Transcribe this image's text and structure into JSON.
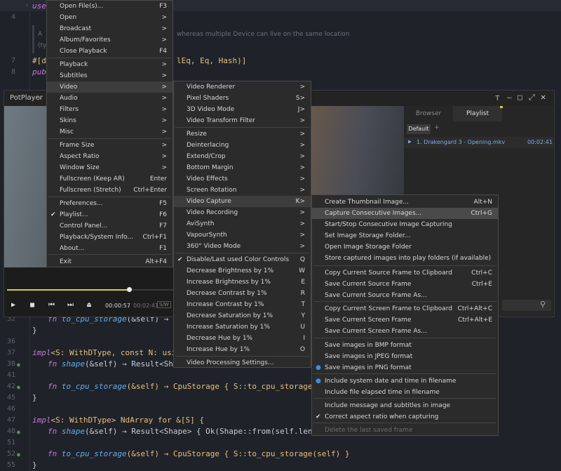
{
  "editor": {
    "line_numbers": [
      "1",
      "4",
      "7",
      "8",
      "32",
      "36",
      "37",
      "38",
      "41",
      "42",
      "45",
      "46",
      "47",
      "48",
      "51",
      "52",
      "55"
    ],
    "lines": {
      "l1": "use",
      "l4a": "A",
      "l4b": "(ty",
      "doc_tail": "whereas multiple Device can live on the same location",
      "l7a": "#[de",
      "l7b": "lEq, Eq, Hash)]",
      "l8": "pub",
      "l32a": "fn",
      "l32b": "to_cpu_storage",
      "l32c": "(&self) → CpuS",
      "l33": "}",
      "l37a": "impl",
      "l37b": "<S: WithDType, const N: usize>",
      "l38a": "fn",
      "l38b": "shape",
      "l38c": "(&self) → Result<Shape",
      "l42a": "fn",
      "l42b": "to_cpu_storage",
      "l42c": "(&self) → CpuStorage { S::to_cpu_storage(self.a",
      "l43": "}",
      "l47a": "impl",
      "l47b": "<S: WithDType> NdArray for &[S] {",
      "l48a": "fn",
      "l48b": "shape",
      "l48c": "(&self) → Result<Shape> { Ok(Shape::from(self.len())) }",
      "l52a": "fn",
      "l52b": "to_cpu_storage",
      "l52c": "(&self) → CpuStorage { S::to_cpu_storage(self) }",
      "l53": "}"
    }
  },
  "player": {
    "app_name": "PotPlayer",
    "tabs": [
      "Browser",
      "Playlist"
    ],
    "playlist_tabs": [
      "Default",
      "+"
    ],
    "playlist_item": "1. Drakengard 3 - Opening.mkv",
    "playlist_duration": "00:02:41",
    "time_current": "00:00:57",
    "time_sep": "/",
    "time_total": "00:02:41",
    "badge": "S/W",
    "progress_fraction": 0.31
  },
  "main_menu": [
    {
      "label": "Open File(s)...",
      "shortcut": "F3"
    },
    {
      "label": "Open",
      "shortcut": ">"
    },
    {
      "label": "Broadcast",
      "shortcut": ">"
    },
    {
      "label": "Album/Favorites",
      "shortcut": ">"
    },
    {
      "label": "Close Playback",
      "shortcut": "F4"
    },
    {
      "label": "Playback",
      "shortcut": ">"
    },
    {
      "label": "Subtitles",
      "shortcut": ">"
    },
    {
      "label": "Video",
      "shortcut": ">"
    },
    {
      "label": "Audio",
      "shortcut": ">"
    },
    {
      "label": "Filters",
      "shortcut": ">"
    },
    {
      "label": "Skins",
      "shortcut": ">"
    },
    {
      "label": "Misc",
      "shortcut": ">"
    },
    {
      "label": "Frame Size",
      "shortcut": ">"
    },
    {
      "label": "Aspect Ratio",
      "shortcut": ">"
    },
    {
      "label": "Window Size",
      "shortcut": ">"
    },
    {
      "label": "Fullscreen (Keep AR)",
      "shortcut": "Enter"
    },
    {
      "label": "Fullscreen (Stretch)",
      "shortcut": "Ctrl+Enter"
    },
    {
      "label": "Preferences...",
      "shortcut": "F5"
    },
    {
      "label": "Playlist...",
      "shortcut": "F6"
    },
    {
      "label": "Control Panel...",
      "shortcut": "F7"
    },
    {
      "label": "Playback/System Info...",
      "shortcut": "Ctrl+F1"
    },
    {
      "label": "About...",
      "shortcut": "F1"
    },
    {
      "label": "Exit",
      "shortcut": "Alt+F4"
    }
  ],
  "video_menu": [
    {
      "label": "Video Renderer",
      "shortcut": ">"
    },
    {
      "label": "Pixel Shaders",
      "shortcut": "S>"
    },
    {
      "label": "3D Video Mode",
      "shortcut": "J>"
    },
    {
      "label": "Video Transform Filter",
      "shortcut": ">"
    },
    {
      "label": "Resize",
      "shortcut": ">"
    },
    {
      "label": "Deinterlacing",
      "shortcut": ">"
    },
    {
      "label": "Extend/Crop",
      "shortcut": ">"
    },
    {
      "label": "Bottom Margin",
      "shortcut": ">"
    },
    {
      "label": "Video Effects",
      "shortcut": ">"
    },
    {
      "label": "Screen Rotation",
      "shortcut": ">"
    },
    {
      "label": "Video Capture",
      "shortcut": "K>"
    },
    {
      "label": "Video Recording",
      "shortcut": ">"
    },
    {
      "label": "AviSynth",
      "shortcut": ">"
    },
    {
      "label": "VapourSynth",
      "shortcut": ">"
    },
    {
      "label": "360° Video Mode",
      "shortcut": ">"
    },
    {
      "label": "Disable/Last used Color Controls",
      "shortcut": "Q"
    },
    {
      "label": "Decrease Brightness by 1%",
      "shortcut": "W"
    },
    {
      "label": "Increase Brightness by 1%",
      "shortcut": "E"
    },
    {
      "label": "Decrease Contrast by 1%",
      "shortcut": "R"
    },
    {
      "label": "Increase Contrast by 1%",
      "shortcut": "T"
    },
    {
      "label": "Decrease Saturation by 1%",
      "shortcut": "Y"
    },
    {
      "label": "Increase Saturation by 1%",
      "shortcut": "U"
    },
    {
      "label": "Decrease Hue by 1%",
      "shortcut": "I"
    },
    {
      "label": "Increase Hue by 1%",
      "shortcut": "O"
    },
    {
      "label": "Video Processing Settings...",
      "shortcut": ""
    }
  ],
  "capture_menu": [
    {
      "label": "Create Thumbnail Image...",
      "shortcut": "Alt+N"
    },
    {
      "label": "Capture Consecutive Images...",
      "shortcut": "Ctrl+G"
    },
    {
      "label": "Start/Stop Consecutive Image Capturing",
      "shortcut": ""
    },
    {
      "label": "Set Image Storage Folder...",
      "shortcut": ""
    },
    {
      "label": "Open Image Storage Folder",
      "shortcut": ""
    },
    {
      "label": "Store captured images into play folders (if available)",
      "shortcut": ""
    },
    {
      "label": "Copy Current Source Frame to Clipboard",
      "shortcut": "Ctrl+C"
    },
    {
      "label": "Save Current Source Frame",
      "shortcut": "Ctrl+E"
    },
    {
      "label": "Save Current Source Frame As...",
      "shortcut": ""
    },
    {
      "label": "Copy Current Screen Frame to Clipboard",
      "shortcut": "Ctrl+Alt+C"
    },
    {
      "label": "Save Current Screen Frame",
      "shortcut": "Ctrl+Alt+E"
    },
    {
      "label": "Save Current Screen Frame As...",
      "shortcut": ""
    },
    {
      "label": "Save images in BMP format",
      "shortcut": ""
    },
    {
      "label": "Save images in JPEG format",
      "shortcut": ""
    },
    {
      "label": "Save images in PNG format",
      "shortcut": ""
    },
    {
      "label": "Include system date and time in filename",
      "shortcut": ""
    },
    {
      "label": "Include file elapsed time in filename",
      "shortcut": ""
    },
    {
      "label": "Include message and subtitles in image",
      "shortcut": ""
    },
    {
      "label": "Correct aspect ratio when capturing",
      "shortcut": ""
    },
    {
      "label": "Delete the last saved frame",
      "shortcut": ""
    }
  ],
  "colors": {
    "accent": "#3b8ee0",
    "highlight": "#3d3d3d",
    "menu_bg": "#2b2b2b"
  }
}
